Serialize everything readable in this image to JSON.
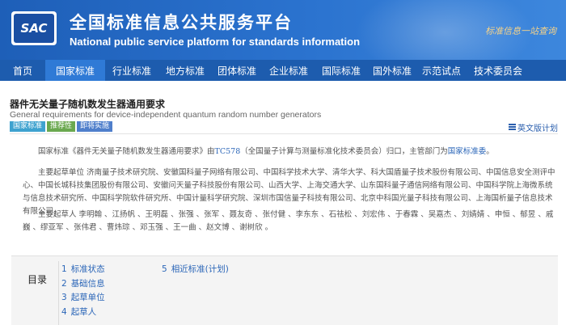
{
  "header": {
    "logo_text": "SAC",
    "title": "全国标准信息公共服务平台",
    "subtitle": "National public service platform  for standards information",
    "slogan": "标准信息一站查询"
  },
  "nav": {
    "items": [
      {
        "label": "首页",
        "active": false
      },
      {
        "label": "国家标准",
        "active": true
      },
      {
        "label": "行业标准",
        "active": false
      },
      {
        "label": "地方标准",
        "active": false
      },
      {
        "label": "团体标准",
        "active": false
      },
      {
        "label": "企业标准",
        "active": false
      },
      {
        "label": "国际标准",
        "active": false
      },
      {
        "label": "国外标准",
        "active": false
      },
      {
        "label": "示范试点",
        "active": false
      },
      {
        "label": "技术委员会",
        "active": false
      }
    ]
  },
  "standard": {
    "title": "器件无关量子随机数发生器通用要求",
    "title_en": "General requirements for device-independent quantum random number generators",
    "tags": [
      "国家标准",
      "推荐性",
      "即将实施"
    ],
    "en_plan_label": "英文版计划"
  },
  "body": {
    "p1_pre": "国家标准《器件无关量子随机数发生器通用要求》由",
    "p1_tc": "TC578",
    "p1_mid": "（全国量子计算与测量标准化技术委员会）归口，主管部门为",
    "p1_dept": "国家标准委",
    "p1_end": "。",
    "p2": "主要起草单位 济南量子技术研究院、安徽国科量子网络有限公司、中国科学技术大学、清华大学、科大国盾量子技术股份有限公司、中国信息安全测评中心、中国长城科技集团股份有限公司、安徽问天量子科技股份有限公司、山西大学、上海交通大学、山东国科量子通信网络有限公司、中国科学院上海微系统与信息技术研究所、中国科学院软件研究所、中国计量科学研究院、深圳市国信量子科技有限公司、北京中科国光量子科技有限公司、上海国析量子信息技术有限公司。",
    "p3": "主要起草人 李明翰 、江扬帆 、王明磊 、张强 、张军 、聂友奇 、张付健 、李东东 、石祛松 、刘宏伟 、于春霖 、吴嘉杰 、刘婧婧 、申恒 、郁昱 、戚巍 、缪亚军 、张伟君 、曹炜琮 、邓玉强 、王一曲 、赵文博 、谢树欣 。"
  },
  "directory": {
    "label": "目录",
    "col1": [
      {
        "num": "1",
        "label": "标准状态"
      },
      {
        "num": "2",
        "label": "基础信息"
      },
      {
        "num": "3",
        "label": "起草单位"
      },
      {
        "num": "4",
        "label": "起草人"
      }
    ],
    "col2": [
      {
        "num": "5",
        "label": "相近标准(计划)"
      }
    ]
  },
  "colors": {
    "header_blue": "#1e5fb8",
    "nav_blue": "#1d5cae",
    "nav_active": "#2f7ad6",
    "link_blue": "#2b66b8"
  }
}
